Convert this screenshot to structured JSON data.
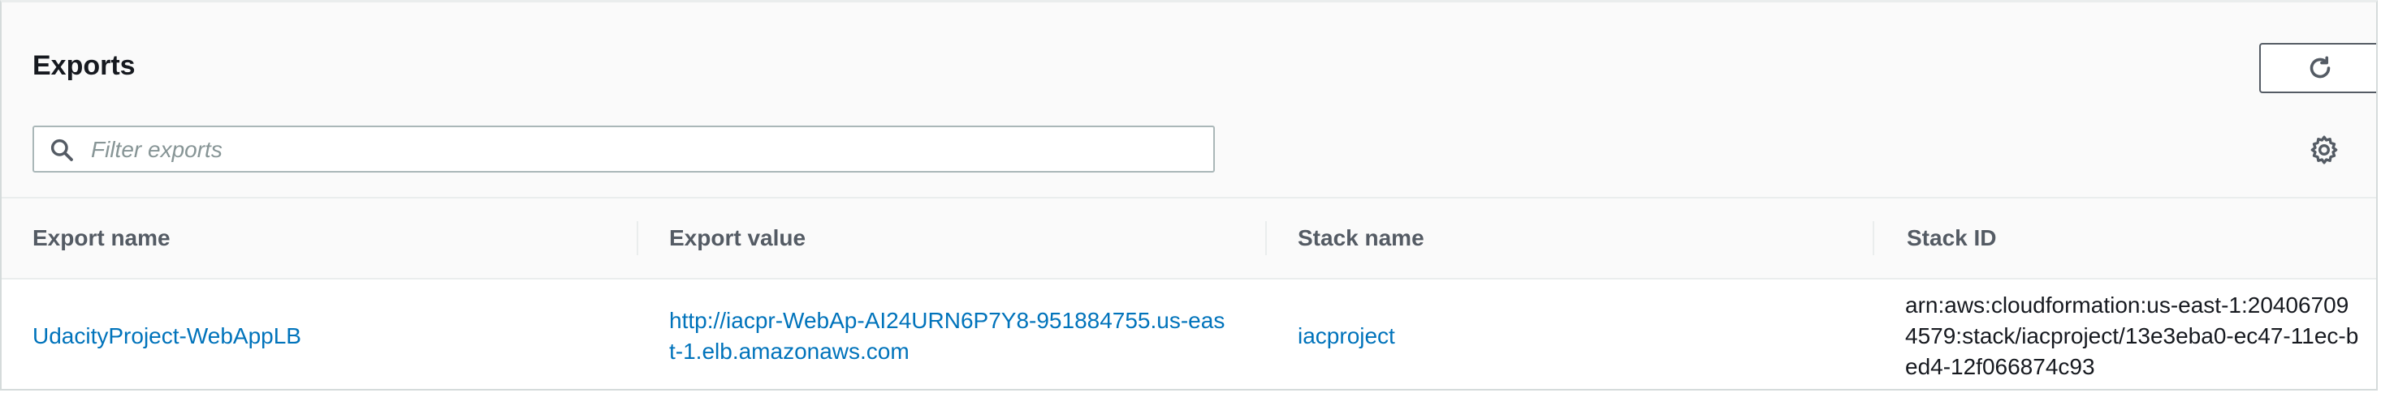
{
  "header": {
    "title": "Exports",
    "refresh_icon": "refresh-icon",
    "settings_icon": "gear-icon"
  },
  "search": {
    "placeholder": "Filter exports",
    "value": "",
    "icon": "search-icon"
  },
  "table": {
    "columns": [
      "Export name",
      "Export value",
      "Stack name",
      "Stack ID"
    ],
    "rows": [
      {
        "export_name": "UdacityProject-WebAppLB",
        "export_value": "http://iacpr-WebAp-AI24URN6P7Y8-951884755.us-east-1.elb.amazonaws.com",
        "stack_name": "iacproject",
        "stack_id": "arn:aws:cloudformation:us-east-1:204067094579:stack/iacproject/13e3eba0-ec47-11ec-bed4-12f066874c93"
      }
    ]
  },
  "colors": {
    "link": "#0073bb",
    "header_bg": "#fafafa",
    "border": "#eaeded",
    "text": "#16191f",
    "muted": "#545b64"
  }
}
